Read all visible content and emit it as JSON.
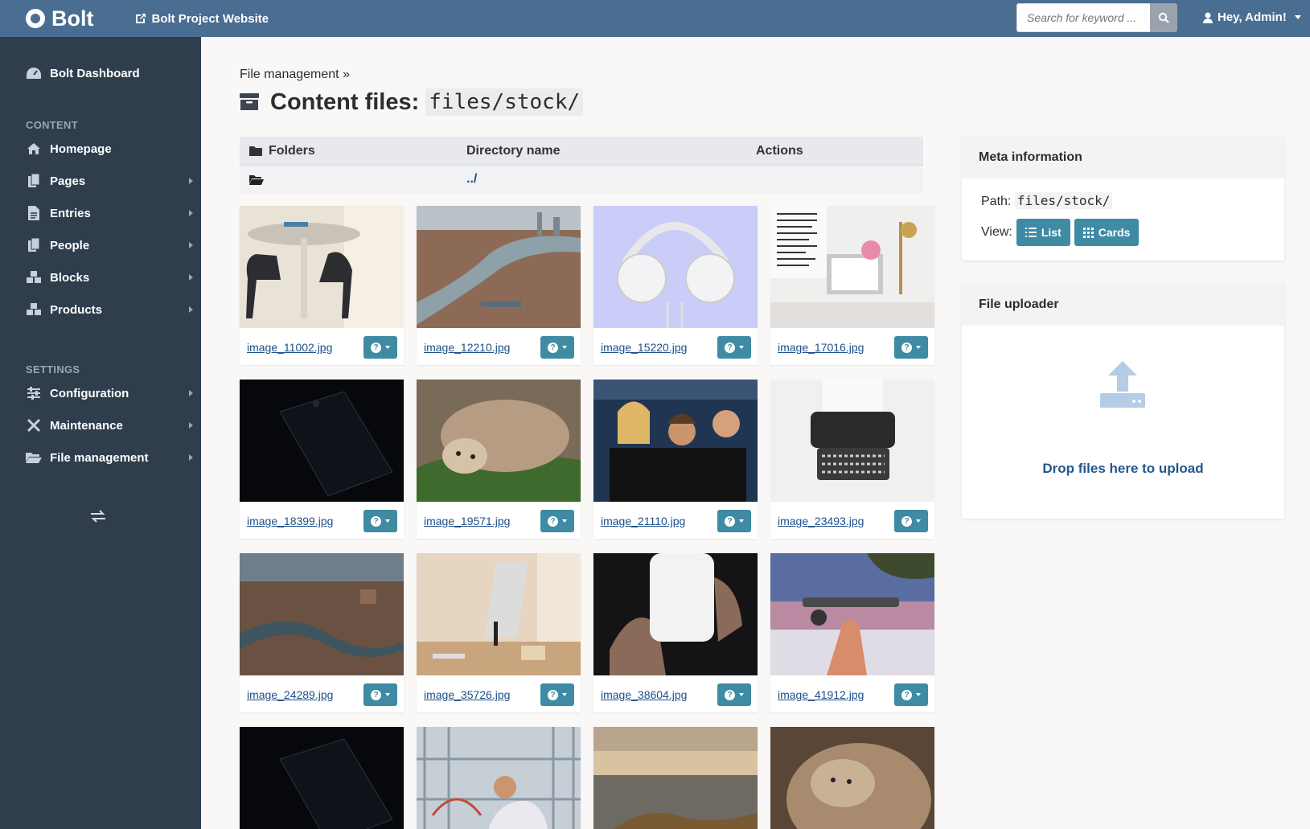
{
  "topbar": {
    "brand": "Bolt",
    "site_link": "Bolt Project Website",
    "search_placeholder": "Search for keyword ...",
    "user": "Hey, Admin!"
  },
  "sidebar": {
    "dashboard": "Bolt Dashboard",
    "content_heading": "CONTENT",
    "content_items": [
      {
        "label": "Homepage",
        "icon": "home-icon"
      },
      {
        "label": "Pages",
        "icon": "pages-icon"
      },
      {
        "label": "Entries",
        "icon": "entries-icon"
      },
      {
        "label": "People",
        "icon": "people-icon"
      },
      {
        "label": "Blocks",
        "icon": "blocks-icon"
      },
      {
        "label": "Products",
        "icon": "products-icon"
      }
    ],
    "settings_heading": "SETTINGS",
    "settings_items": [
      {
        "label": "Configuration",
        "icon": "sliders-icon"
      },
      {
        "label": "Maintenance",
        "icon": "tools-icon"
      },
      {
        "label": "File management",
        "icon": "folder-open-icon"
      }
    ]
  },
  "main": {
    "breadcrumb": "File management »",
    "title": "Content files:",
    "title_path": "files/stock/",
    "folders_table": {
      "headers": [
        "Folders",
        "Directory name",
        "Actions"
      ],
      "parent_dir": "../"
    },
    "files": [
      "image_11002.jpg",
      "image_12210.jpg",
      "image_15220.jpg",
      "image_17016.jpg",
      "image_18399.jpg",
      "image_19571.jpg",
      "image_21110.jpg",
      "image_23493.jpg",
      "image_24289.jpg",
      "image_35726.jpg",
      "image_38604.jpg",
      "image_41912.jpg"
    ]
  },
  "meta": {
    "heading": "Meta information",
    "path_label": "Path:",
    "path_value": "files/stock/",
    "view_label": "View:",
    "list_label": "List",
    "cards_label": "Cards"
  },
  "uploader": {
    "heading": "File uploader",
    "drop_text": "Drop files here to upload"
  },
  "colors": {
    "topbar": "#4a6d92",
    "sidebar": "#2f3d4c",
    "accent_button": "#3f8ba3",
    "link": "#1c4f8a"
  }
}
